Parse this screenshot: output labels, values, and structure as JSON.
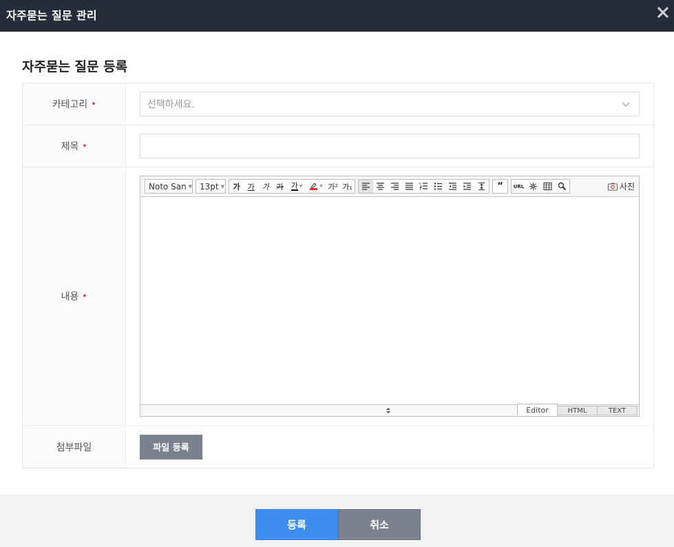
{
  "window": {
    "title": "자주묻는 질문 관리",
    "close_icon": "close-icon"
  },
  "section": {
    "title": "자주묻는 질문 등록"
  },
  "form": {
    "category": {
      "label": "카테고리",
      "required_mark": "•",
      "placeholder": "선택하세요."
    },
    "subject": {
      "label": "제목",
      "required_mark": "•",
      "value": ""
    },
    "content": {
      "label": "내용",
      "required_mark": "•"
    },
    "attachment": {
      "label": "첨부파일",
      "button_label": "파일 등록"
    }
  },
  "editor": {
    "font_family": "Noto San",
    "font_size": "13pt",
    "format_buttons": [
      "가",
      "가",
      "가",
      "가",
      "가"
    ],
    "superscript": "가²",
    "subscript": "가₁",
    "url_label": "URL",
    "photo_label": "사진",
    "modes": [
      "Editor",
      "HTML",
      "TEXT"
    ],
    "active_mode": "Editor"
  },
  "footer": {
    "submit_label": "등록",
    "cancel_label": "취소"
  },
  "colors": {
    "titlebar": "#262d3a",
    "primary": "#3d8ef0",
    "secondary": "#7b818e",
    "required": "#e02a2a"
  }
}
